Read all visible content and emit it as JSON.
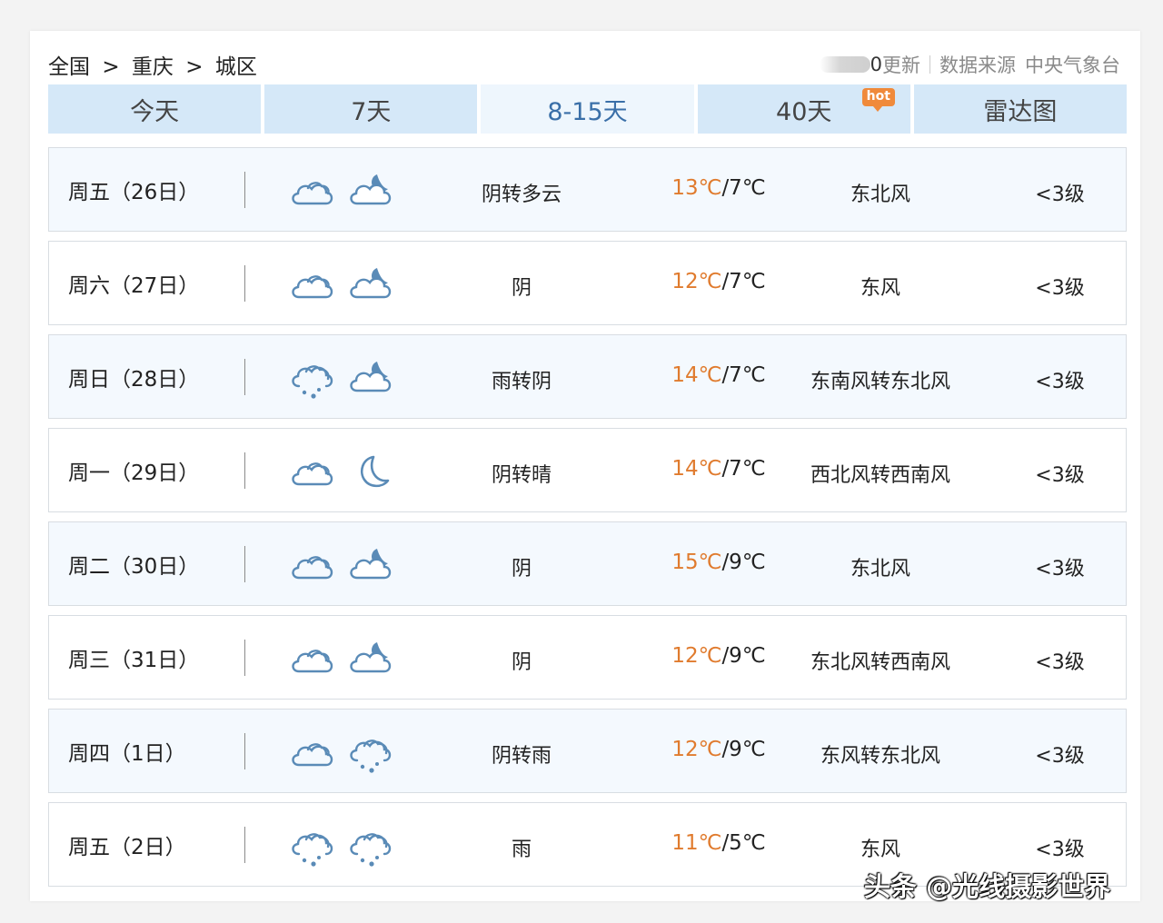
{
  "breadcrumb": [
    "全国",
    "重庆",
    "城区"
  ],
  "breadcrumb_sep": ">",
  "source": {
    "update_count": "0",
    "update_label": "更新",
    "source_label": "数据来源",
    "source_name": "中央气象台"
  },
  "tabs": [
    {
      "label": "今天"
    },
    {
      "label": "7天"
    },
    {
      "label": "8-15天"
    },
    {
      "label": "40天",
      "badge": "hot"
    },
    {
      "label": "雷达图"
    }
  ],
  "active_tab": 2,
  "colors": {
    "accent": "#3a6fa8",
    "high_temp": "#e07b2e",
    "tab_bg": "#d5e8f8",
    "hot_badge": "#f08a3b"
  },
  "rows": [
    {
      "date": "周五（26日）",
      "day_icon": "cloudy-icon",
      "night_icon": "partly-cloudy-night-icon",
      "weather": "阴转多云",
      "high": "13℃",
      "low": "/7℃",
      "wind": "东北风",
      "level": "<3级"
    },
    {
      "date": "周六（27日）",
      "day_icon": "cloudy-icon",
      "night_icon": "partly-cloudy-night-icon",
      "weather": "阴",
      "high": "12℃",
      "low": "/7℃",
      "wind": "东风",
      "level": "<3级"
    },
    {
      "date": "周日（28日）",
      "day_icon": "rain-icon",
      "night_icon": "partly-cloudy-night-icon",
      "weather": "雨转阴",
      "high": "14℃",
      "low": "/7℃",
      "wind": "东南风转东北风",
      "level": "<3级"
    },
    {
      "date": "周一（29日）",
      "day_icon": "cloudy-icon",
      "night_icon": "moon-icon",
      "weather": "阴转晴",
      "high": "14℃",
      "low": "/7℃",
      "wind": "西北风转西南风",
      "level": "<3级"
    },
    {
      "date": "周二（30日）",
      "day_icon": "cloudy-icon",
      "night_icon": "partly-cloudy-night-icon",
      "weather": "阴",
      "high": "15℃",
      "low": "/9℃",
      "wind": "东北风",
      "level": "<3级"
    },
    {
      "date": "周三（31日）",
      "day_icon": "cloudy-icon",
      "night_icon": "partly-cloudy-night-icon",
      "weather": "阴",
      "high": "12℃",
      "low": "/9℃",
      "wind": "东北风转西南风",
      "level": "<3级"
    },
    {
      "date": "周四（1日）",
      "day_icon": "cloudy-icon",
      "night_icon": "rain-icon",
      "weather": "阴转雨",
      "high": "12℃",
      "low": "/9℃",
      "wind": "东风转东北风",
      "level": "<3级"
    },
    {
      "date": "周五（2日）",
      "day_icon": "rain-icon",
      "night_icon": "rain-icon",
      "weather": "雨",
      "high": "11℃",
      "low": "/5℃",
      "wind": "东风",
      "level": "<3级"
    }
  ],
  "watermark": "头条 @光线摄影世界"
}
